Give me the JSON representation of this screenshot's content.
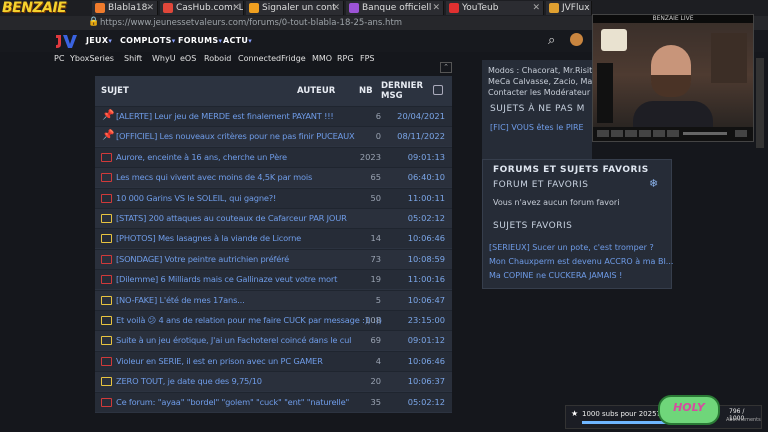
{
  "brand": {
    "text": "BENZAIE"
  },
  "tabs": [
    {
      "label": "Blabla18-",
      "color": "#f07b2c"
    },
    {
      "label": "CasHub.com: Le",
      "color": "#e0473a"
    },
    {
      "label": "Signaler un cont",
      "color": "#f0a020"
    },
    {
      "label": "Banque officiell",
      "color": "#9c53d6"
    },
    {
      "label": "YouTeub",
      "color": "#e03030"
    },
    {
      "label": "JVFlux",
      "color": "#e0a030"
    }
  ],
  "address": {
    "url": "https://www.jeunessetvaleurs.com/forums/0-tout-blabla-18-25-ans.htm"
  },
  "nav": {
    "items": [
      "JEUX",
      "COMPLOTS",
      "FORUMS",
      "ACTU"
    ],
    "subitems": [
      "PC",
      "YboxSeries",
      "Shift",
      "WhyU",
      "eOS",
      "Roboid",
      "ConnectedFridge",
      "MMO",
      "RPG",
      "FPS"
    ]
  },
  "forum": {
    "headers": {
      "sujet": "SUJET",
      "auteur": "AUTEUR",
      "nb": "NB",
      "dernier1": "DERNIER",
      "dernier2": "MSG"
    },
    "rows": [
      {
        "title": "[ALERTE] Leur jeu de MERDE est finalement PAYANT !!!",
        "count": "6",
        "date": "20/04/2021",
        "icon": "pin",
        "color": "#d03a3a"
      },
      {
        "title": "[OFFICIEL] Les nouveaux critères pour ne pas finir PUCEAUX",
        "count": "0",
        "date": "08/11/2022",
        "icon": "pin",
        "color": "#d03a3a"
      },
      {
        "title": "Aurore, enceinte à 16 ans, cherche un Père",
        "count": "2023",
        "date": "09:01:13",
        "icon": "folder",
        "color": "#d03a3a"
      },
      {
        "title": "Les mecs qui vivent avec moins de 4,5K par mois",
        "count": "65",
        "date": "06:40:10",
        "icon": "folder",
        "color": "#d03a3a"
      },
      {
        "title": "10 000 Garins VS le SOLEIL, qui gagne?!",
        "count": "50",
        "date": "11:00:11",
        "icon": "folder",
        "color": "#d03a3a"
      },
      {
        "title": "[STATS] 200 attaques au couteaux de Cafarceur PAR JOUR",
        "count": "",
        "date": "05:02:12",
        "icon": "folder",
        "color": "#e8c440"
      },
      {
        "title": "[PHOTOS] Mes lasagnes à la viande de Licorne",
        "count": "14",
        "date": "10:06:46",
        "icon": "folder",
        "color": "#e8c440"
      },
      {
        "title": "[SONDAGE] Votre peintre autrichien préféré",
        "count": "73",
        "date": "10:08:59",
        "icon": "folder",
        "color": "#d03a3a"
      },
      {
        "title": "[Dilemme] 6 Milliards mais ce Gallinaze veut votre mort",
        "count": "19",
        "date": "11:00:16",
        "icon": "folder",
        "color": "#d03a3a"
      },
      {
        "title": "[NO-FAKE] L'été de mes 17ans...",
        "count": "5",
        "date": "10:06:47",
        "icon": "folder",
        "color": "#e8c440"
      },
      {
        "title": "Et voilà 😕 4 ans de relation pour me faire CUCK par message :)) :))",
        "count": "108",
        "date": "23:15:00",
        "icon": "folder",
        "color": "#e8c440"
      },
      {
        "title": "Suite à un jeu érotique, J'ai un Fachoterel coincé dans le cul",
        "count": "69",
        "date": "09:01:12",
        "icon": "folder",
        "color": "#e8c440"
      },
      {
        "title": "Violeur en SERIE, il est en prison avec un PC GAMER",
        "count": "4",
        "date": "10:06:46",
        "icon": "folder",
        "color": "#d03a3a"
      },
      {
        "title": "ZERO TOUT, je date que des 9,75/10",
        "count": "20",
        "date": "10:06:37",
        "icon": "folder",
        "color": "#e8c440"
      },
      {
        "title": "Ce forum: \"ayaa\" \"bordel\" \"golem\" \"cuck\" \"ent\" \"naturelle\"",
        "count": "35",
        "date": "05:02:12",
        "icon": "folder",
        "color": "#d03a3a"
      }
    ]
  },
  "sidebar": {
    "mods": "Modos : Chacorat, Mr.Risit",
    "mods2": "MeCa Calvasse, Zacio, Ma",
    "contact": "Contacter les Modérateur",
    "sujets_pas": "SUJETS À NE PAS M",
    "fic": "[FIC] VOUS êtes le PIRE",
    "fav_title": "FORUMS ET SUJETS FAVORIS",
    "forum_fav_head": "FORUM ET FAVORIS",
    "forum_fav_empty": "Vous n'avez aucun forum favori",
    "sujets_fav_head": "SUJETS FAVORIS",
    "fav1": "[SERIEUX] Sucer un pote, c'est tromper ?",
    "fav2": "Mon Chauxperm est devenu ACCRO à ma BI...",
    "fav3": "Ma COPINE ne CUCKERA JAMAIS !"
  },
  "overlay": {
    "cam_title": "BENZAIE LIVE",
    "subs_text": "1000 subs pour 2025?",
    "subs_count": "796 / 1000",
    "subs_label": "Abonnements",
    "holy": "HOLY"
  }
}
